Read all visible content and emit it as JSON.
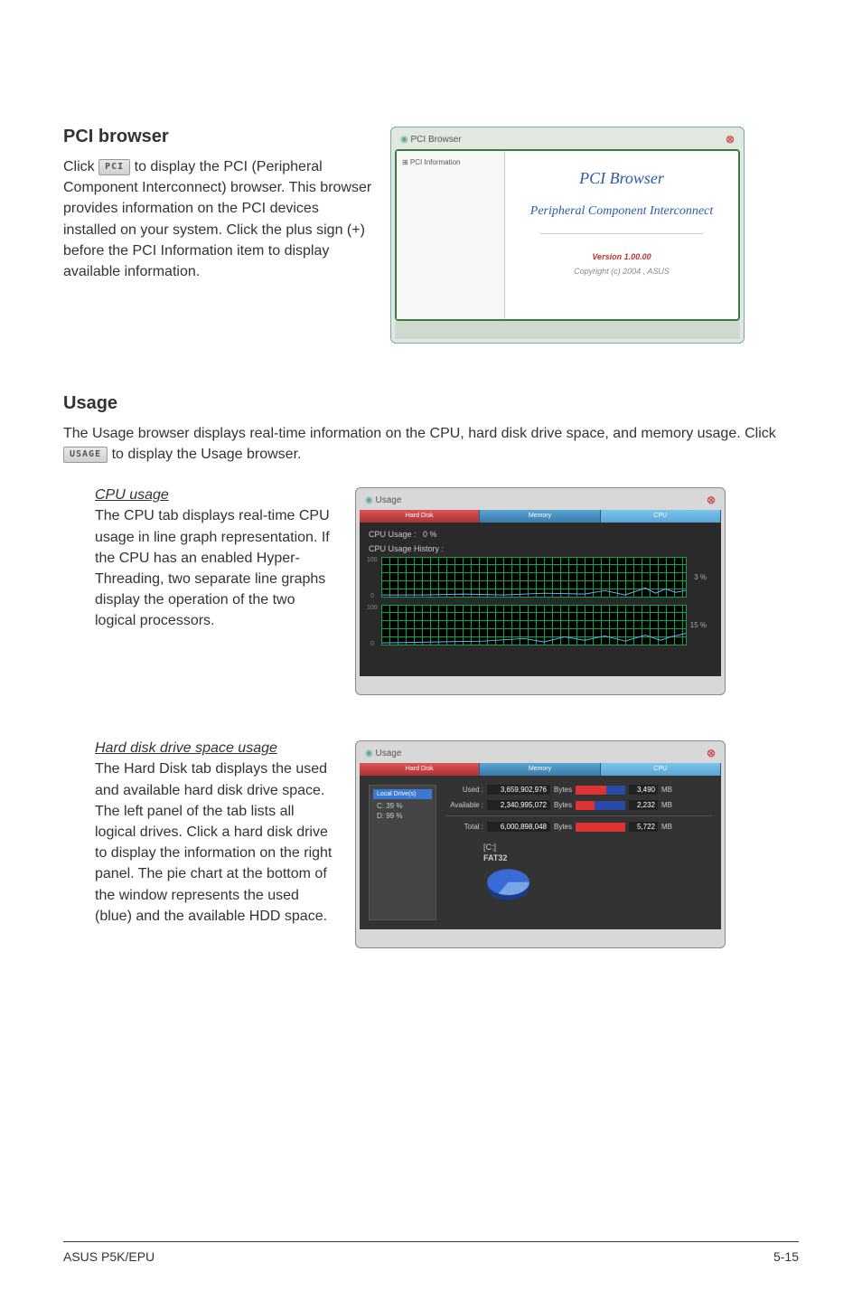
{
  "pci": {
    "title": "PCI browser",
    "text_before_btn": "Click ",
    "btn_label": "PCI",
    "text_after_btn": " to display the PCI (Peripheral Component Interconnect) browser. This browser provides information on the PCI devices installed on your system. Click the plus sign (+) before the PCI Information item to display available information.",
    "window": {
      "titlebar": "PCI Browser",
      "tree_item": "⊞ PCI Information",
      "content_title": "PCI Browser",
      "content_subtitle": "Peripheral Component Interconnect",
      "version": "Version 1.00.00",
      "copyright": "Copyright (c) 2004 , ASUS"
    }
  },
  "usage": {
    "title": "Usage",
    "intro_before_btn": "The Usage browser displays real-time information on the CPU, hard disk drive space, and memory usage. Click ",
    "btn_label": "USAGE",
    "intro_after_btn": " to display the Usage browser.",
    "cpu": {
      "subtitle": "CPU usage",
      "text": "The CPU tab displays real-time CPU usage in line graph representation. If the CPU has an enabled Hyper-Threading, two separate line graphs display the operation of the two logical processors.",
      "window": {
        "titlebar": "Usage",
        "tabs": [
          "Hard Disk",
          "Memory",
          "CPU"
        ],
        "cpu_usage_label": "CPU Usage :",
        "cpu_usage_value": "0  %",
        "history_label": "CPU Usage History :",
        "axis_top": "100",
        "axis_bot": "0",
        "pct1": "3 %",
        "pct2": "15 %"
      }
    },
    "hdd": {
      "subtitle": "Hard disk drive space usage",
      "text": "The Hard Disk tab displays the used and available hard disk drive space. The left panel of the tab lists all logical drives. Click a hard disk drive to display the information on the right panel. The pie chart at the bottom of the window represents the used (blue) and the available HDD space.",
      "window": {
        "titlebar": "Usage",
        "tabs": [
          "Hard Disk",
          "Memory",
          "CPU"
        ],
        "drives_header": "Local Drive(s)",
        "drives": [
          "C:  39 %",
          "D:  99 %"
        ],
        "rows": [
          {
            "label": "Used :",
            "bytes": "3,659,902,976",
            "unit": "Bytes",
            "mb": "3,490",
            "mbunit": "MB",
            "fill": 61
          },
          {
            "label": "Available :",
            "bytes": "2,340,995,072",
            "unit": "Bytes",
            "mb": "2,232",
            "mbunit": "MB",
            "fill": 39
          },
          {
            "label": "Total :",
            "bytes": "6,000,898,048",
            "unit": "Bytes",
            "mb": "5,722",
            "mbunit": "MB",
            "fill": 100
          }
        ],
        "pie_label1": "[C:]",
        "pie_label2": "FAT32"
      }
    }
  },
  "chart_data": [
    {
      "type": "line",
      "title": "CPU Usage History (processor 1)",
      "ylim": [
        0,
        100
      ],
      "values_approx": "low noise ~2-5% on green grid",
      "readout": "3 %"
    },
    {
      "type": "line",
      "title": "CPU Usage History (processor 2)",
      "ylim": [
        0,
        100
      ],
      "values_approx": "low noise ~5-18% on green grid",
      "readout": "15 %"
    },
    {
      "type": "pie",
      "title": "[C:] FAT32",
      "series": [
        {
          "name": "Used",
          "value": 3659902976,
          "color": "#2a4aaa"
        },
        {
          "name": "Available",
          "value": 2340995072,
          "color": "#7aa5e5"
        }
      ]
    }
  ],
  "footer": {
    "left": "ASUS P5K/EPU",
    "right": "5-15"
  }
}
